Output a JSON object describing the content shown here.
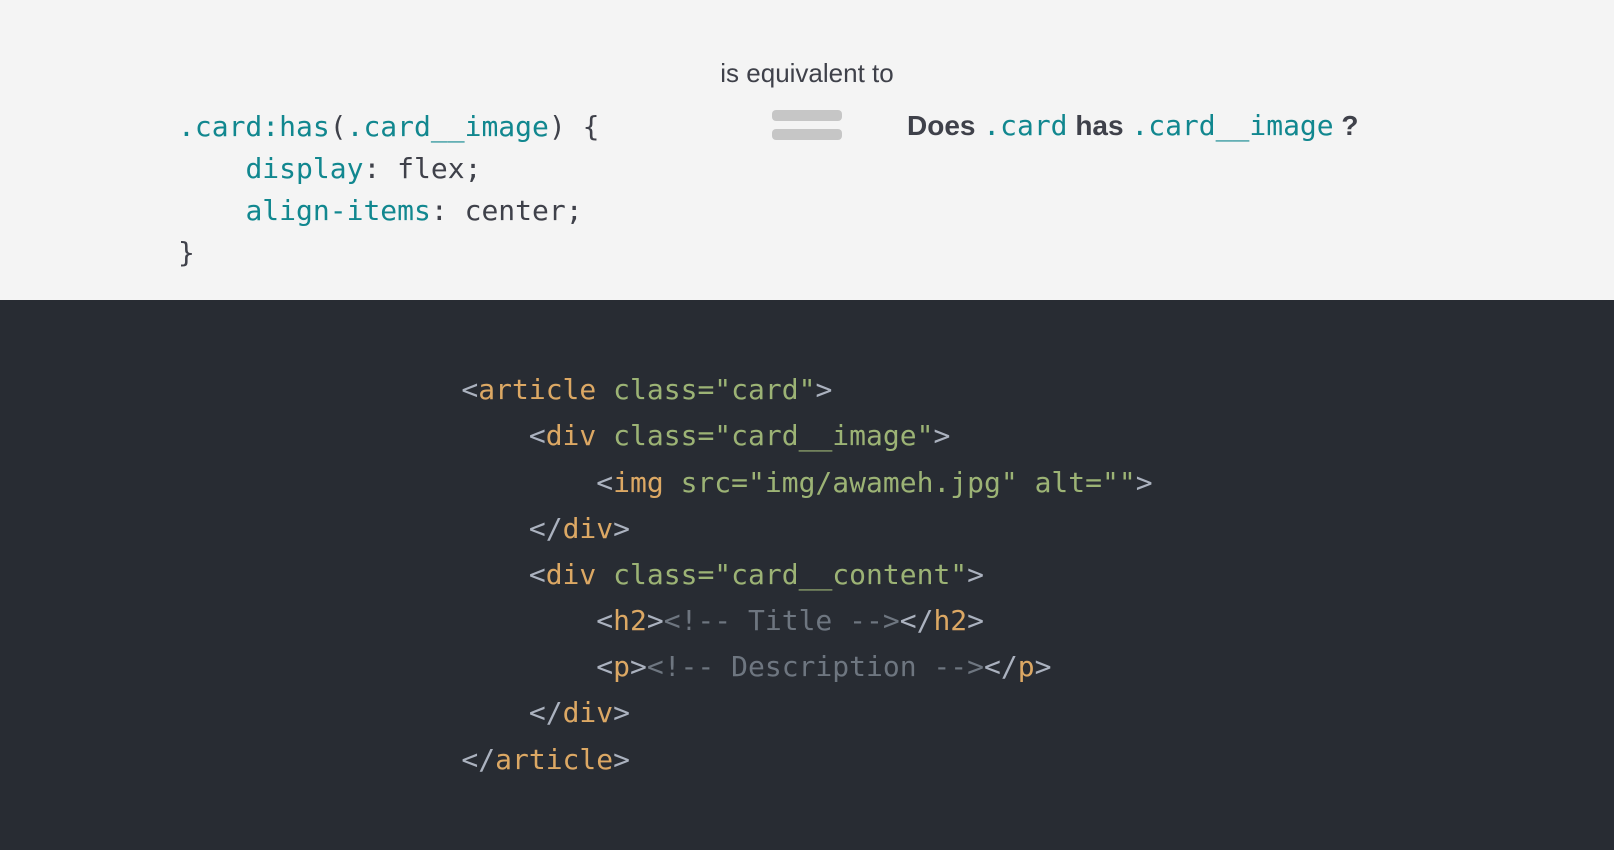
{
  "top": {
    "equiv_label": "is equivalent to",
    "css": {
      "l1_s1": ".card",
      "l1_s2": ":has",
      "l1_s3": "(",
      "l1_s4": ".card__image",
      "l1_s5": ")",
      "l1_s6": " {",
      "l2_prop": "display",
      "l2_val": ": flex;",
      "l3_prop": "align-items",
      "l3_val": ": center;",
      "l4": "}"
    },
    "question": {
      "w1": "Does ",
      "w2": ".card",
      "w3": " has ",
      "w4": ".card__image",
      "w5": " ?"
    }
  },
  "html": {
    "l1_a": "<",
    "l1_b": "article",
    "l1_c": " ",
    "l1_d": "class",
    "l1_e": "=\"card\"",
    "l1_f": ">",
    "l2_a": "<",
    "l2_b": "div",
    "l2_c": " ",
    "l2_d": "class",
    "l2_e": "=\"card__image\"",
    "l2_f": ">",
    "l3_a": "<",
    "l3_b": "img",
    "l3_c": " ",
    "l3_d": "src",
    "l3_e": "=\"img/awameh.jpg\"",
    "l3_f": " ",
    "l3_g": "alt",
    "l3_h": "=\"\"",
    "l3_i": ">",
    "l4_a": "</",
    "l4_b": "div",
    "l4_c": ">",
    "l5_a": "<",
    "l5_b": "div",
    "l5_c": " ",
    "l5_d": "class",
    "l5_e": "=\"card__content\"",
    "l5_f": ">",
    "l6_a": "<",
    "l6_b": "h2",
    "l6_c": ">",
    "l6_d": "<!-- Title -->",
    "l6_e": "</",
    "l6_f": "h2",
    "l6_g": ">",
    "l7_a": "<",
    "l7_b": "p",
    "l7_c": ">",
    "l7_d": "<!-- Description -->",
    "l7_e": "</",
    "l7_f": "p",
    "l7_g": ">",
    "l8_a": "</",
    "l8_b": "div",
    "l8_c": ">",
    "l9_a": "</",
    "l9_b": "article",
    "l9_c": ">"
  }
}
